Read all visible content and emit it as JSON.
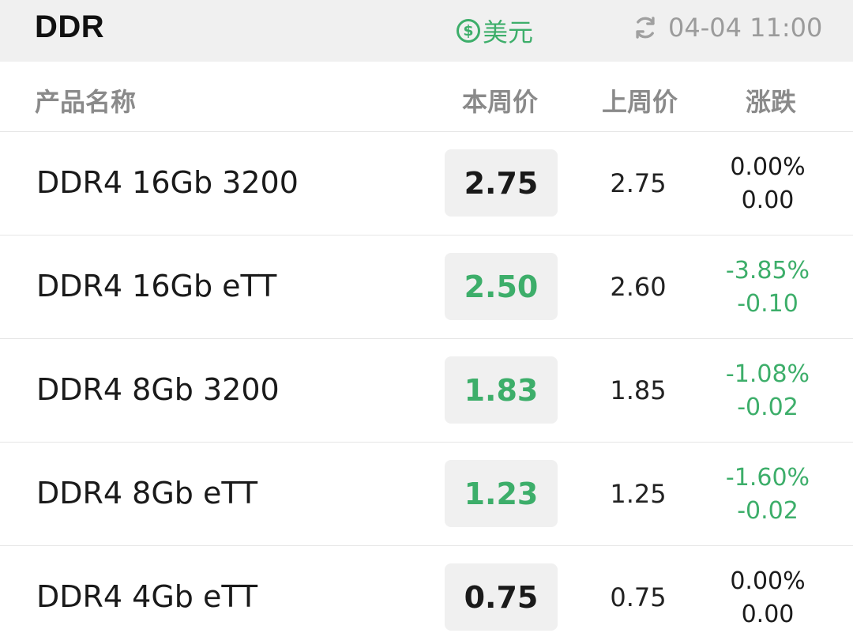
{
  "header": {
    "title": "DDR",
    "currency_label": "美元",
    "currency_icon": "dollar-icon",
    "refresh_icon": "refresh-icon",
    "timestamp": "04-04 11:00"
  },
  "columns": {
    "name": "产品名称",
    "this_week": "本周价",
    "last_week": "上周价",
    "change": "涨跌"
  },
  "colors": {
    "down": "#3dae6a",
    "flat": "#1a1a1a",
    "price_box_bg": "#f0f0f0"
  },
  "rows": [
    {
      "name": "DDR4 16Gb 3200",
      "this_week": "2.75",
      "last_week": "2.75",
      "change_pct": "0.00%",
      "change_abs": "0.00",
      "trend": "flat"
    },
    {
      "name": "DDR4 16Gb eTT",
      "this_week": "2.50",
      "last_week": "2.60",
      "change_pct": "-3.85%",
      "change_abs": "-0.10",
      "trend": "down"
    },
    {
      "name": "DDR4 8Gb 3200",
      "this_week": "1.83",
      "last_week": "1.85",
      "change_pct": "-1.08%",
      "change_abs": "-0.02",
      "trend": "down"
    },
    {
      "name": "DDR4 8Gb eTT",
      "this_week": "1.23",
      "last_week": "1.25",
      "change_pct": "-1.60%",
      "change_abs": "-0.02",
      "trend": "down"
    },
    {
      "name": "DDR4 4Gb eTT",
      "this_week": "0.75",
      "last_week": "0.75",
      "change_pct": "0.00%",
      "change_abs": "0.00",
      "trend": "flat"
    }
  ]
}
